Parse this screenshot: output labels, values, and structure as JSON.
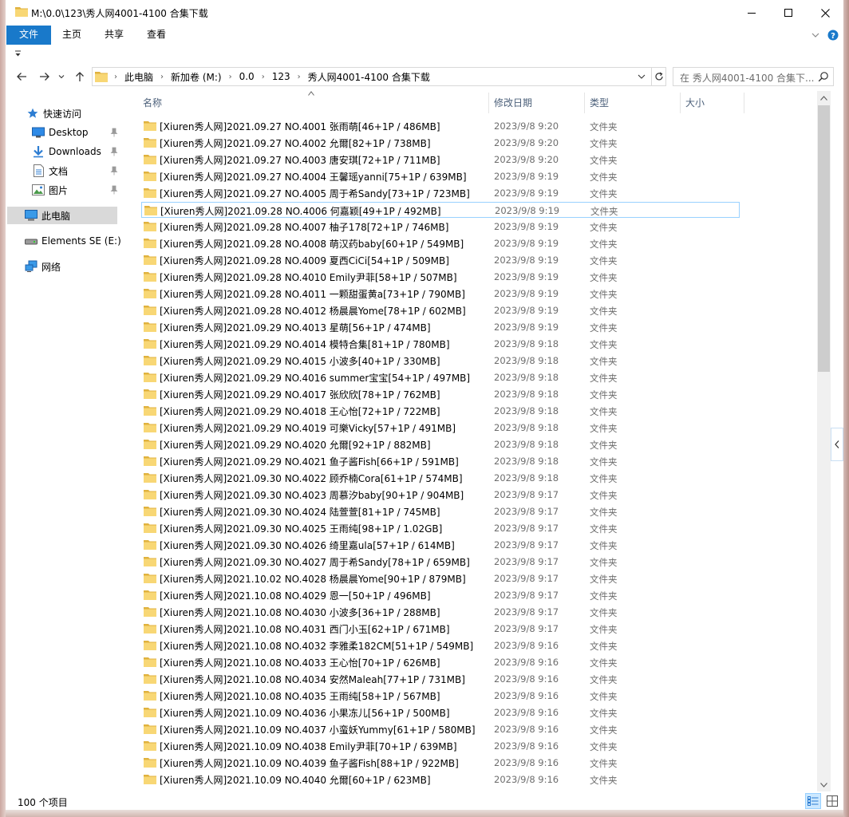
{
  "window": {
    "title": "M:\\0.0\\123\\秀人网4001-4100 合集下载"
  },
  "ribbon": {
    "tabs": [
      "文件",
      "主页",
      "共享",
      "查看"
    ]
  },
  "address": {
    "crumbs": [
      "此电脑",
      "新加卷 (M:)",
      "0.0",
      "123",
      "秀人网4001-4100 合集下载"
    ]
  },
  "search": {
    "placeholder": "在 秀人网4001-4100 合集下..."
  },
  "nav": {
    "items": [
      "快速访问",
      "Desktop",
      "Downloads",
      "文档",
      "图片",
      "此电脑",
      "Elements SE (E:)",
      "网络"
    ]
  },
  "columns": {
    "name": "名称",
    "date": "修改日期",
    "type": "类型",
    "size": "大小"
  },
  "files": [
    {
      "name": "[Xiuren秀人网]2021.09.27 NO.4001 张雨萌[46+1P / 486MB]",
      "date": "2023/9/8 9:20",
      "type": "文件夹"
    },
    {
      "name": "[Xiuren秀人网]2021.09.27 NO.4002 允爾[82+1P / 738MB]",
      "date": "2023/9/8 9:20",
      "type": "文件夹"
    },
    {
      "name": "[Xiuren秀人网]2021.09.27 NO.4003 唐安琪[72+1P / 711MB]",
      "date": "2023/9/8 9:20",
      "type": "文件夹"
    },
    {
      "name": "[Xiuren秀人网]2021.09.27 NO.4004 王馨瑶yanni[75+1P / 639MB]",
      "date": "2023/9/8 9:19",
      "type": "文件夹"
    },
    {
      "name": "[Xiuren秀人网]2021.09.27 NO.4005 周于希Sandy[73+1P / 723MB]",
      "date": "2023/9/8 9:19",
      "type": "文件夹"
    },
    {
      "name": "[Xiuren秀人网]2021.09.28 NO.4006 何嘉颖[49+1P / 492MB]",
      "date": "2023/9/8 9:19",
      "type": "文件夹"
    },
    {
      "name": "[Xiuren秀人网]2021.09.28 NO.4007 柚子178[72+1P / 746MB]",
      "date": "2023/9/8 9:19",
      "type": "文件夹"
    },
    {
      "name": "[Xiuren秀人网]2021.09.28 NO.4008 萌汉药baby[60+1P / 549MB]",
      "date": "2023/9/8 9:19",
      "type": "文件夹"
    },
    {
      "name": "[Xiuren秀人网]2021.09.28 NO.4009 夏西CiCi[54+1P / 509MB]",
      "date": "2023/9/8 9:19",
      "type": "文件夹"
    },
    {
      "name": "[Xiuren秀人网]2021.09.28 NO.4010 Emily尹菲[58+1P / 507MB]",
      "date": "2023/9/8 9:19",
      "type": "文件夹"
    },
    {
      "name": "[Xiuren秀人网]2021.09.28 NO.4011 一颗甜蛋黄a[73+1P / 790MB]",
      "date": "2023/9/8 9:19",
      "type": "文件夹"
    },
    {
      "name": "[Xiuren秀人网]2021.09.28 NO.4012 杨晨晨Yome[78+1P / 602MB]",
      "date": "2023/9/8 9:19",
      "type": "文件夹"
    },
    {
      "name": "[Xiuren秀人网]2021.09.29 NO.4013 星萌[56+1P / 474MB]",
      "date": "2023/9/8 9:19",
      "type": "文件夹"
    },
    {
      "name": "[Xiuren秀人网]2021.09.29 NO.4014 模特合集[81+1P / 780MB]",
      "date": "2023/9/8 9:18",
      "type": "文件夹"
    },
    {
      "name": "[Xiuren秀人网]2021.09.29 NO.4015 小波多[40+1P / 330MB]",
      "date": "2023/9/8 9:18",
      "type": "文件夹"
    },
    {
      "name": "[Xiuren秀人网]2021.09.29 NO.4016 summer宝宝[54+1P / 497MB]",
      "date": "2023/9/8 9:18",
      "type": "文件夹"
    },
    {
      "name": "[Xiuren秀人网]2021.09.29 NO.4017 张欣欣[78+1P / 762MB]",
      "date": "2023/9/8 9:18",
      "type": "文件夹"
    },
    {
      "name": "[Xiuren秀人网]2021.09.29 NO.4018 王心怡[72+1P / 722MB]",
      "date": "2023/9/8 9:18",
      "type": "文件夹"
    },
    {
      "name": "[Xiuren秀人网]2021.09.29 NO.4019 可樂Vicky[57+1P / 491MB]",
      "date": "2023/9/8 9:18",
      "type": "文件夹"
    },
    {
      "name": "[Xiuren秀人网]2021.09.29 NO.4020 允爾[92+1P / 882MB]",
      "date": "2023/9/8 9:18",
      "type": "文件夹"
    },
    {
      "name": "[Xiuren秀人网]2021.09.29 NO.4021 鱼子酱Fish[66+1P / 591MB]",
      "date": "2023/9/8 9:18",
      "type": "文件夹"
    },
    {
      "name": "[Xiuren秀人网]2021.09.30 NO.4022 顾乔楠Cora[61+1P / 574MB]",
      "date": "2023/9/8 9:18",
      "type": "文件夹"
    },
    {
      "name": "[Xiuren秀人网]2021.09.30 NO.4023 周慕汐baby[90+1P / 904MB]",
      "date": "2023/9/8 9:17",
      "type": "文件夹"
    },
    {
      "name": "[Xiuren秀人网]2021.09.30 NO.4024 陆萱萱[81+1P / 745MB]",
      "date": "2023/9/8 9:17",
      "type": "文件夹"
    },
    {
      "name": "[Xiuren秀人网]2021.09.30 NO.4025 王雨纯[98+1P / 1.02GB]",
      "date": "2023/9/8 9:17",
      "type": "文件夹"
    },
    {
      "name": "[Xiuren秀人网]2021.09.30 NO.4026 绮里嘉ula[57+1P / 614MB]",
      "date": "2023/9/8 9:17",
      "type": "文件夹"
    },
    {
      "name": "[Xiuren秀人网]2021.09.30 NO.4027 周于希Sandy[78+1P / 659MB]",
      "date": "2023/9/8 9:17",
      "type": "文件夹"
    },
    {
      "name": "[Xiuren秀人网]2021.10.02 NO.4028 杨晨晨Yome[90+1P / 879MB]",
      "date": "2023/9/8 9:17",
      "type": "文件夹"
    },
    {
      "name": "[Xiuren秀人网]2021.10.08 NO.4029 恩一[50+1P / 496MB]",
      "date": "2023/9/8 9:17",
      "type": "文件夹"
    },
    {
      "name": "[Xiuren秀人网]2021.10.08 NO.4030 小波多[36+1P / 288MB]",
      "date": "2023/9/8 9:17",
      "type": "文件夹"
    },
    {
      "name": "[Xiuren秀人网]2021.10.08 NO.4031 西门小玉[62+1P / 671MB]",
      "date": "2023/9/8 9:17",
      "type": "文件夹"
    },
    {
      "name": "[Xiuren秀人网]2021.10.08 NO.4032 李雅柔182CM[51+1P / 549MB]",
      "date": "2023/9/8 9:16",
      "type": "文件夹"
    },
    {
      "name": "[Xiuren秀人网]2021.10.08 NO.4033 王心怡[70+1P / 626MB]",
      "date": "2023/9/8 9:16",
      "type": "文件夹"
    },
    {
      "name": "[Xiuren秀人网]2021.10.08 NO.4034 安然Maleah[77+1P / 731MB]",
      "date": "2023/9/8 9:16",
      "type": "文件夹"
    },
    {
      "name": "[Xiuren秀人网]2021.10.08 NO.4035 王雨纯[58+1P / 567MB]",
      "date": "2023/9/8 9:16",
      "type": "文件夹"
    },
    {
      "name": "[Xiuren秀人网]2021.10.09 NO.4036 小果冻儿[56+1P / 500MB]",
      "date": "2023/9/8 9:16",
      "type": "文件夹"
    },
    {
      "name": "[Xiuren秀人网]2021.10.09 NO.4037 小蛮妖Yummy[61+1P / 580MB]",
      "date": "2023/9/8 9:16",
      "type": "文件夹"
    },
    {
      "name": "[Xiuren秀人网]2021.10.09 NO.4038 Emily尹菲[70+1P / 639MB]",
      "date": "2023/9/8 9:16",
      "type": "文件夹"
    },
    {
      "name": "[Xiuren秀人网]2021.10.09 NO.4039 鱼子酱Fish[88+1P / 922MB]",
      "date": "2023/9/8 9:16",
      "type": "文件夹"
    },
    {
      "name": "[Xiuren秀人网]2021.10.09 NO.4040 允爾[60+1P / 623MB]",
      "date": "2023/9/8 9:16",
      "type": "文件夹"
    }
  ],
  "status": {
    "count": "100 个项目"
  },
  "colors": {
    "accent": "#1979ca",
    "folder": "#f8d775",
    "folder_dark": "#e0b23e",
    "selection_border": "#99d1ff"
  }
}
